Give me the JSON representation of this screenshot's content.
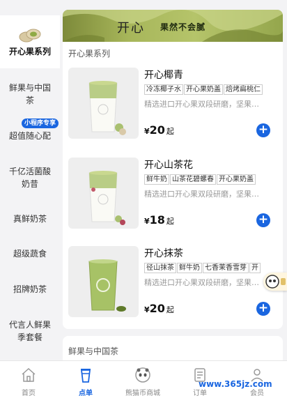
{
  "sidebar": {
    "categories": [
      {
        "label": "开心果系列"
      },
      {
        "label": "鲜果与中国茶"
      },
      {
        "label": "超值随心配",
        "badge": "小程序专享"
      },
      {
        "label": "千亿活菌酸奶昔"
      },
      {
        "label": "真鲜奶茶"
      },
      {
        "label": "超级蔬食"
      },
      {
        "label": "招牌奶茶"
      },
      {
        "label": "代言人鲜果季套餐"
      }
    ]
  },
  "banner": {
    "logo": "开心",
    "slogan": "果然不会腻"
  },
  "sections": [
    {
      "title": "开心果系列",
      "products": [
        {
          "name": "开心椰青",
          "tags": [
            "冷冻椰子水",
            "开心果奶盖",
            "焙烤扁桃仁"
          ],
          "desc": "精选进口开心果双段研磨，坚果…",
          "currency": "¥",
          "price": "20",
          "unit": "起"
        },
        {
          "name": "开心山茶花",
          "tags": [
            "鲜牛奶",
            "山茶花碧螺春",
            "开心果奶盖"
          ],
          "desc": "精选进口开心果双段研磨，坚果…",
          "currency": "¥",
          "price": "18",
          "unit": "起"
        },
        {
          "name": "开心抹茶",
          "tags": [
            "径山抹茶",
            "鲜牛奶",
            "七香茉香雪芽",
            "开"
          ],
          "desc": "精选进口开心果双段研磨，坚果…",
          "currency": "¥",
          "price": "20",
          "unit": "起"
        }
      ]
    },
    {
      "title": "鲜果与中国茶"
    }
  ],
  "tabbar": [
    {
      "label": "首页",
      "icon": "home-icon"
    },
    {
      "label": "点单",
      "icon": "cup-icon"
    },
    {
      "label": "熊猫币商城",
      "icon": "panda-icon"
    },
    {
      "label": "订单",
      "icon": "order-icon"
    },
    {
      "label": "会员",
      "icon": "member-icon"
    }
  ],
  "watermark": "www.365jz.com",
  "colors": {
    "accent": "#1a66e0",
    "matcha": "#9fb35a"
  }
}
